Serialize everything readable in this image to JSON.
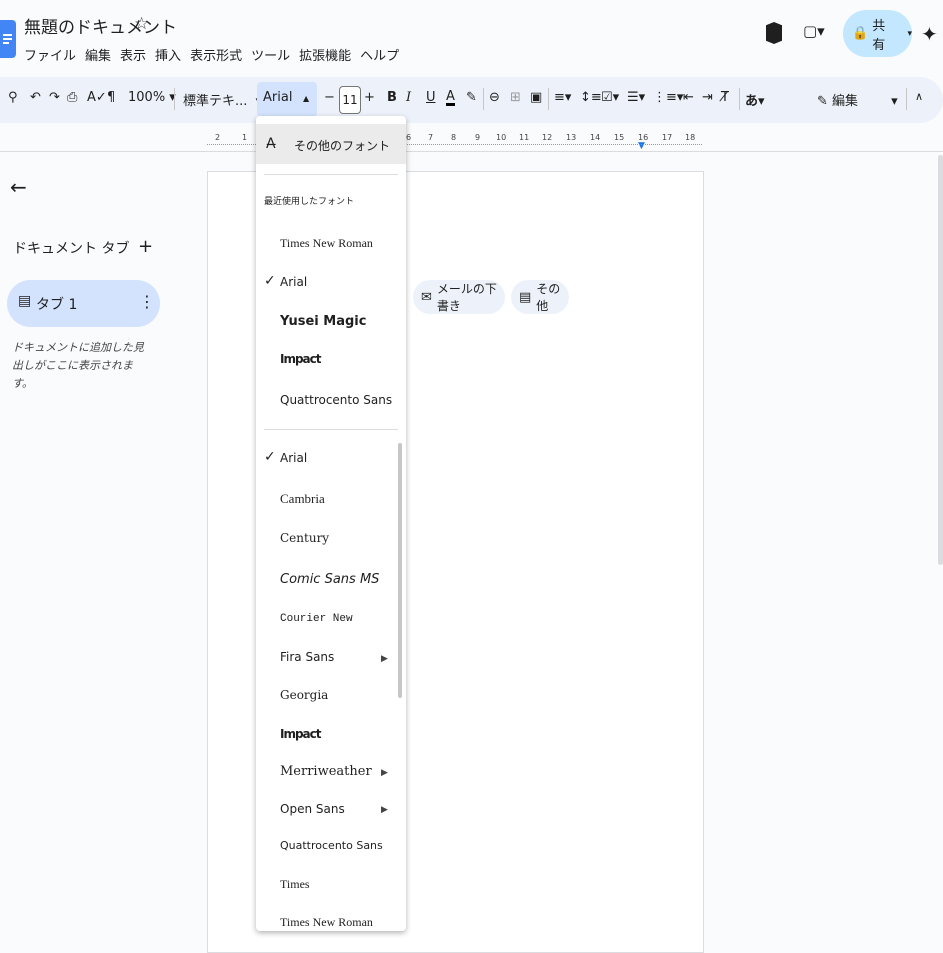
{
  "header": {
    "title": "無題のドキュメント",
    "menu": [
      "ファイル",
      "編集",
      "表示",
      "挿入",
      "表示形式",
      "ツール",
      "拡張機能",
      "ヘルプ"
    ],
    "share_label": "共有"
  },
  "toolbar": {
    "zoom": "100%",
    "style": "標準テキ...",
    "font": "Arial",
    "font_size": "11",
    "edit_mode": "編集"
  },
  "ruler": [
    "2",
    "1",
    "6",
    "7",
    "8",
    "9",
    "10",
    "11",
    "12",
    "13",
    "14",
    "15",
    "16",
    "17",
    "18"
  ],
  "sidebar": {
    "tabs_title": "ドキュメント タブ",
    "tab_label": "タブ 1",
    "hint": "ドキュメントに追加した見出しがここに表示されます。"
  },
  "page": {
    "chips": [
      "メールの下書き",
      "その他"
    ]
  },
  "font_menu": {
    "more_fonts": "その他のフォント",
    "recent_title": "最近使用したフォント",
    "recent": [
      "Times New Roman",
      "Arial",
      "Yusei Magic",
      "Impact",
      "Quattrocento Sans"
    ],
    "all": [
      "Arial",
      "Cambria",
      "Century",
      "Comic Sans MS",
      "Courier New",
      "Fira Sans",
      "Georgia",
      "Impact",
      "Merriweather",
      "Open Sans",
      "Quattrocento Sans",
      "Times",
      "Times New Roman"
    ]
  }
}
